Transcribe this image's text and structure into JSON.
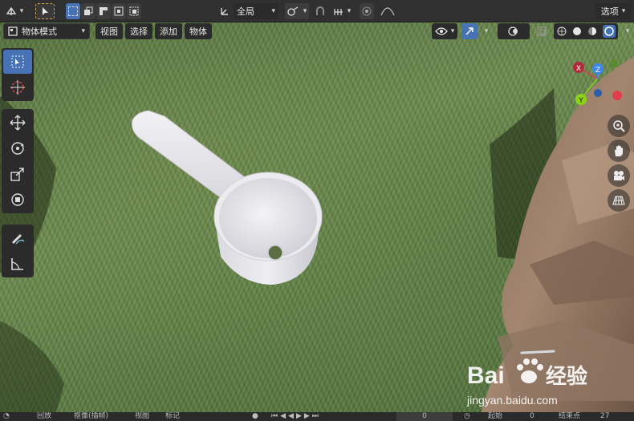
{
  "header": {
    "orientation_label": "全局",
    "options_label": "选项"
  },
  "toolbar_row": {
    "mode_label": "物体模式",
    "menus": [
      {
        "label": "视图"
      },
      {
        "label": "选择"
      },
      {
        "label": "添加"
      },
      {
        "label": "物体"
      }
    ]
  },
  "tools": {
    "group1": [
      "select-box",
      "cursor"
    ],
    "group2": [
      "move",
      "rotate",
      "scale",
      "transform"
    ],
    "group3": [
      "annotate",
      "measure"
    ]
  },
  "gizmo": {
    "x_label": "X",
    "y_label": "Y",
    "z_label": "Z",
    "colors": {
      "x": "#e23d4c",
      "y": "#8ad317",
      "z": "#3f87e9"
    }
  },
  "nav_buttons": [
    "zoom-icon",
    "hand-icon",
    "camera-icon",
    "grid-icon"
  ],
  "bottom_bar": {
    "items": [
      "回放",
      "抠像(插帧)",
      "视图",
      "标记"
    ],
    "frame_current": "0",
    "start_label": "起始",
    "start_value": "0",
    "end_label": "结束点",
    "end_value": "27"
  },
  "watermark": {
    "brand_left": "Bai",
    "brand_right": "经验",
    "url": "jingyan.baidu.com"
  },
  "colors": {
    "accent": "#4772b3",
    "header_bg": "#303030",
    "panel_bg": "#2b2b2b"
  }
}
